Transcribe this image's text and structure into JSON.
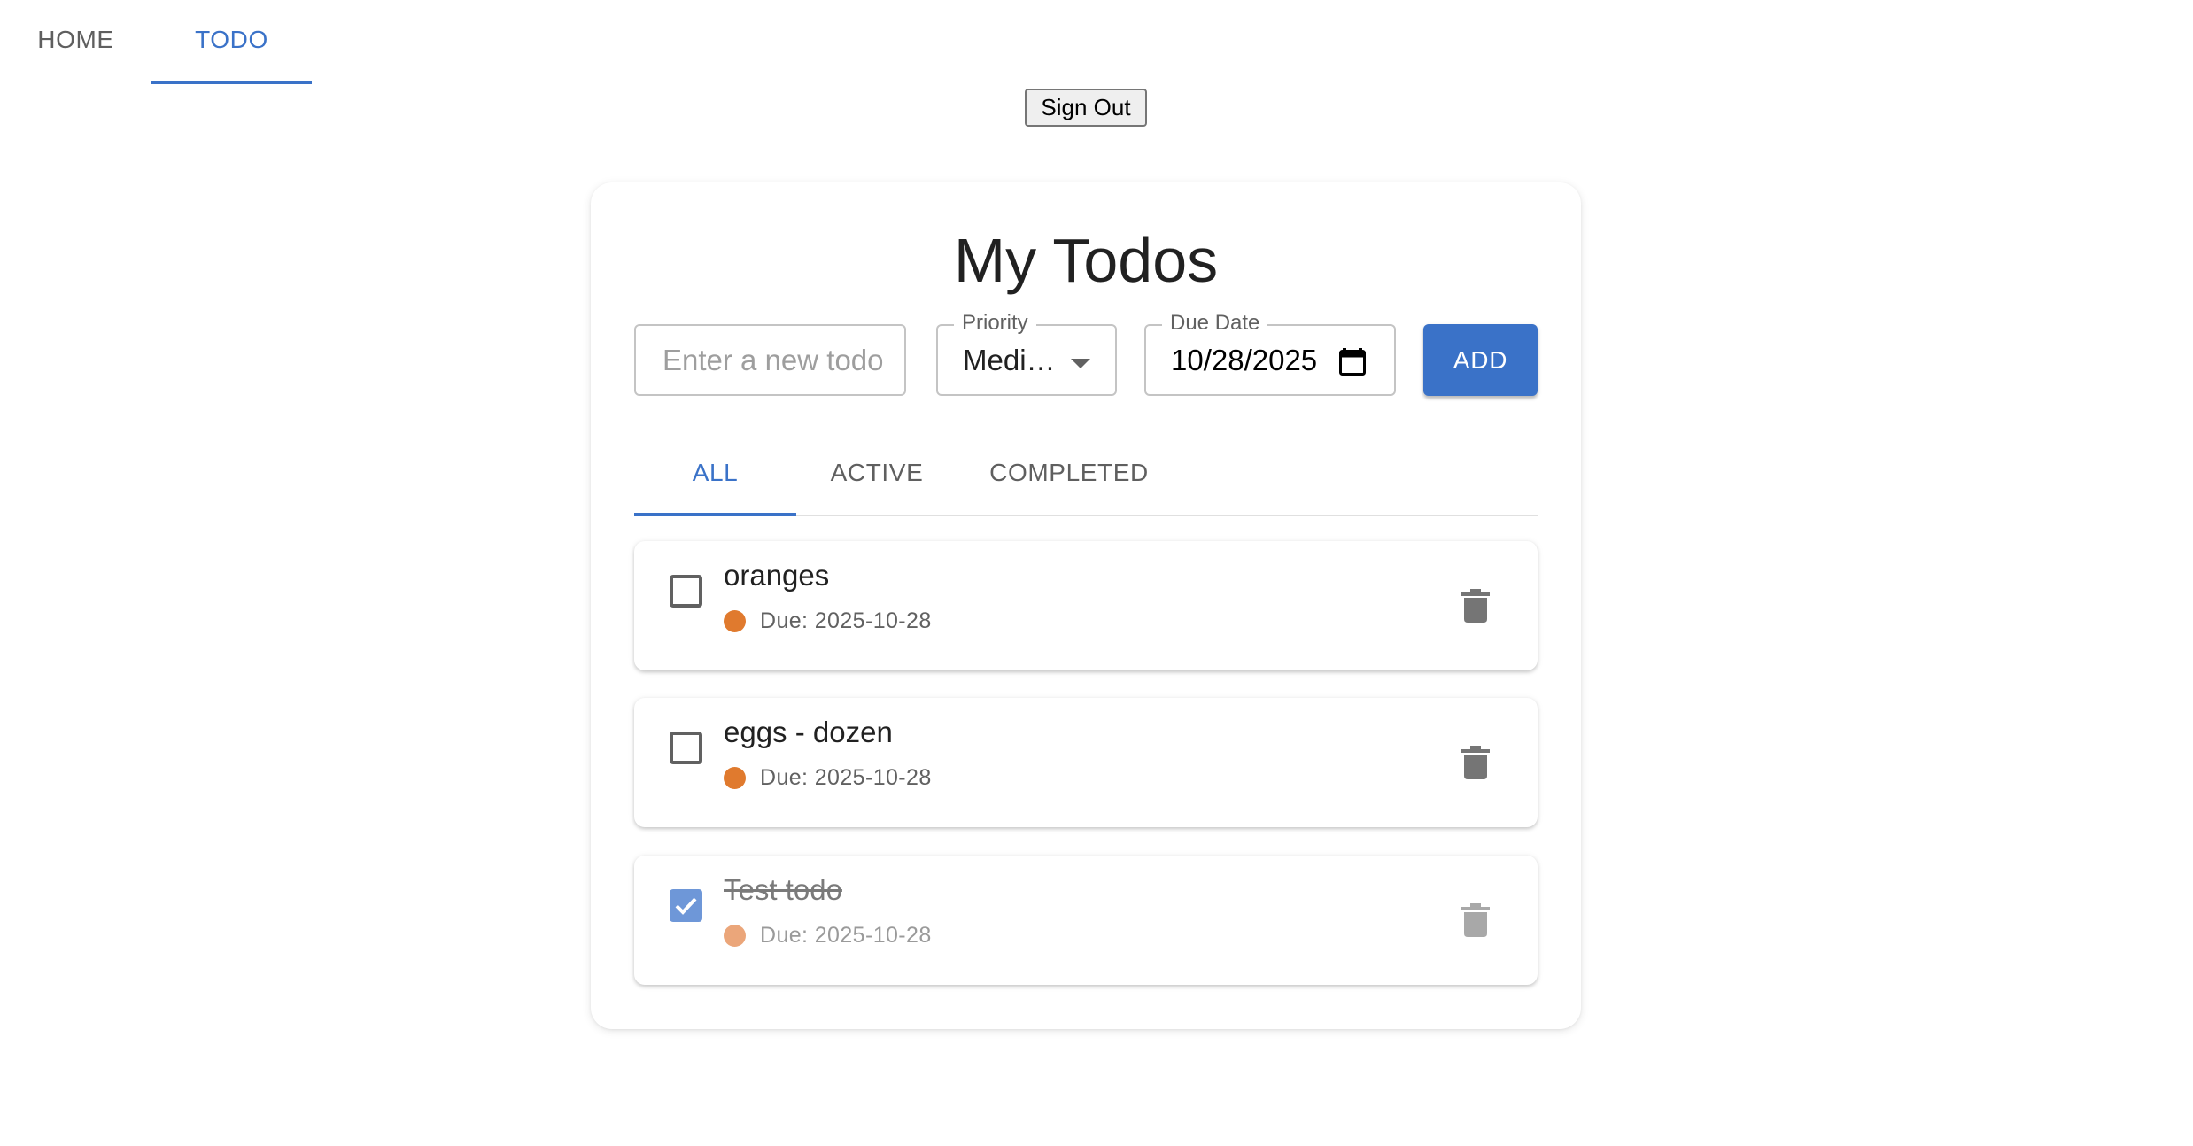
{
  "nav": {
    "tabs": [
      {
        "label": "HOME"
      },
      {
        "label": "TODO"
      }
    ],
    "active_tab": "TODO"
  },
  "auth": {
    "signout_label": "Sign Out"
  },
  "card": {
    "title": "My Todos",
    "new_todo": {
      "placeholder": "Enter a new todo",
      "value": ""
    },
    "priority": {
      "legend": "Priority",
      "value": "Medi…"
    },
    "due_date": {
      "legend": "Due Date",
      "value": "10/28/2025"
    },
    "add_label": "ADD",
    "filters": [
      {
        "label": "ALL"
      },
      {
        "label": "ACTIVE"
      },
      {
        "label": "COMPLETED"
      }
    ],
    "active_filter": "ALL",
    "todos": [
      {
        "text": "oranges",
        "due": "Due: 2025-10-28",
        "completed": false
      },
      {
        "text": "eggs - dozen",
        "due": "Due: 2025-10-28",
        "completed": false
      },
      {
        "text": "Test todo",
        "due": "Due: 2025-10-28",
        "completed": true
      }
    ]
  },
  "colors": {
    "accent": "#3a72c8",
    "priority_medium": "#e07a2e",
    "checked_box": "#6e97d8"
  },
  "icons": {
    "dropdown": "arrow-drop-down-icon",
    "calendar": "calendar-icon",
    "delete": "trash-icon",
    "check": "check-icon"
  }
}
